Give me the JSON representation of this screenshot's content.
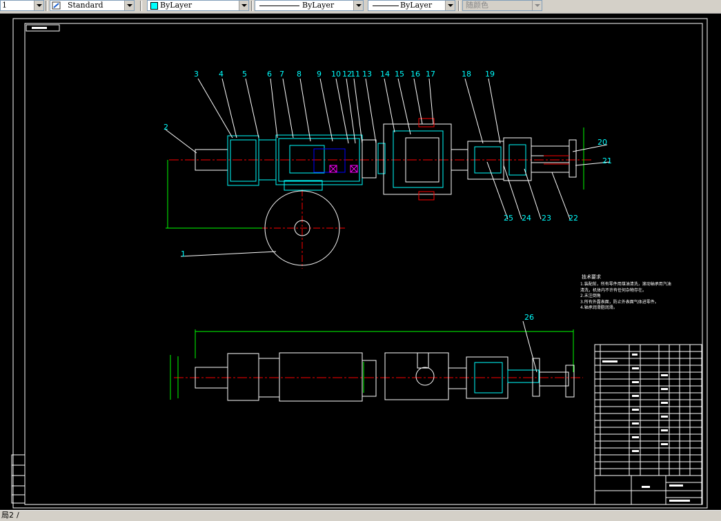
{
  "toolbar": {
    "layer_value": "1",
    "text_style": "Standard",
    "color": "ByLayer",
    "color_swatch": "#00ffff",
    "linetype": "ByLayer",
    "lineweight": "ByLayer",
    "plot_style": "随颜色"
  },
  "drawing": {
    "part_numbers_top": [
      "3",
      "4",
      "5",
      "6",
      "7",
      "8",
      "9",
      "10",
      "12",
      "11",
      "13",
      "14",
      "15",
      "16",
      "17",
      "18",
      "19"
    ],
    "part_numbers_bottom": [
      "25",
      "24",
      "23",
      "22"
    ],
    "label_2": "2",
    "label_1": "1",
    "label_20": "20",
    "label_21": "21",
    "label_26": "26",
    "tech_title": "技术要求",
    "tech_notes": [
      "1.装配前，所有零件用煤油清洗，滚动轴承用汽油",
      "清洗，机体内不许有任何杂物存在。",
      "2.未注倒角",
      "3.所有外露表面，防止外表面气体进零件。",
      "4.轴承润滑脂润滑。"
    ]
  },
  "statusbar": {
    "layout_tab": "局2"
  }
}
